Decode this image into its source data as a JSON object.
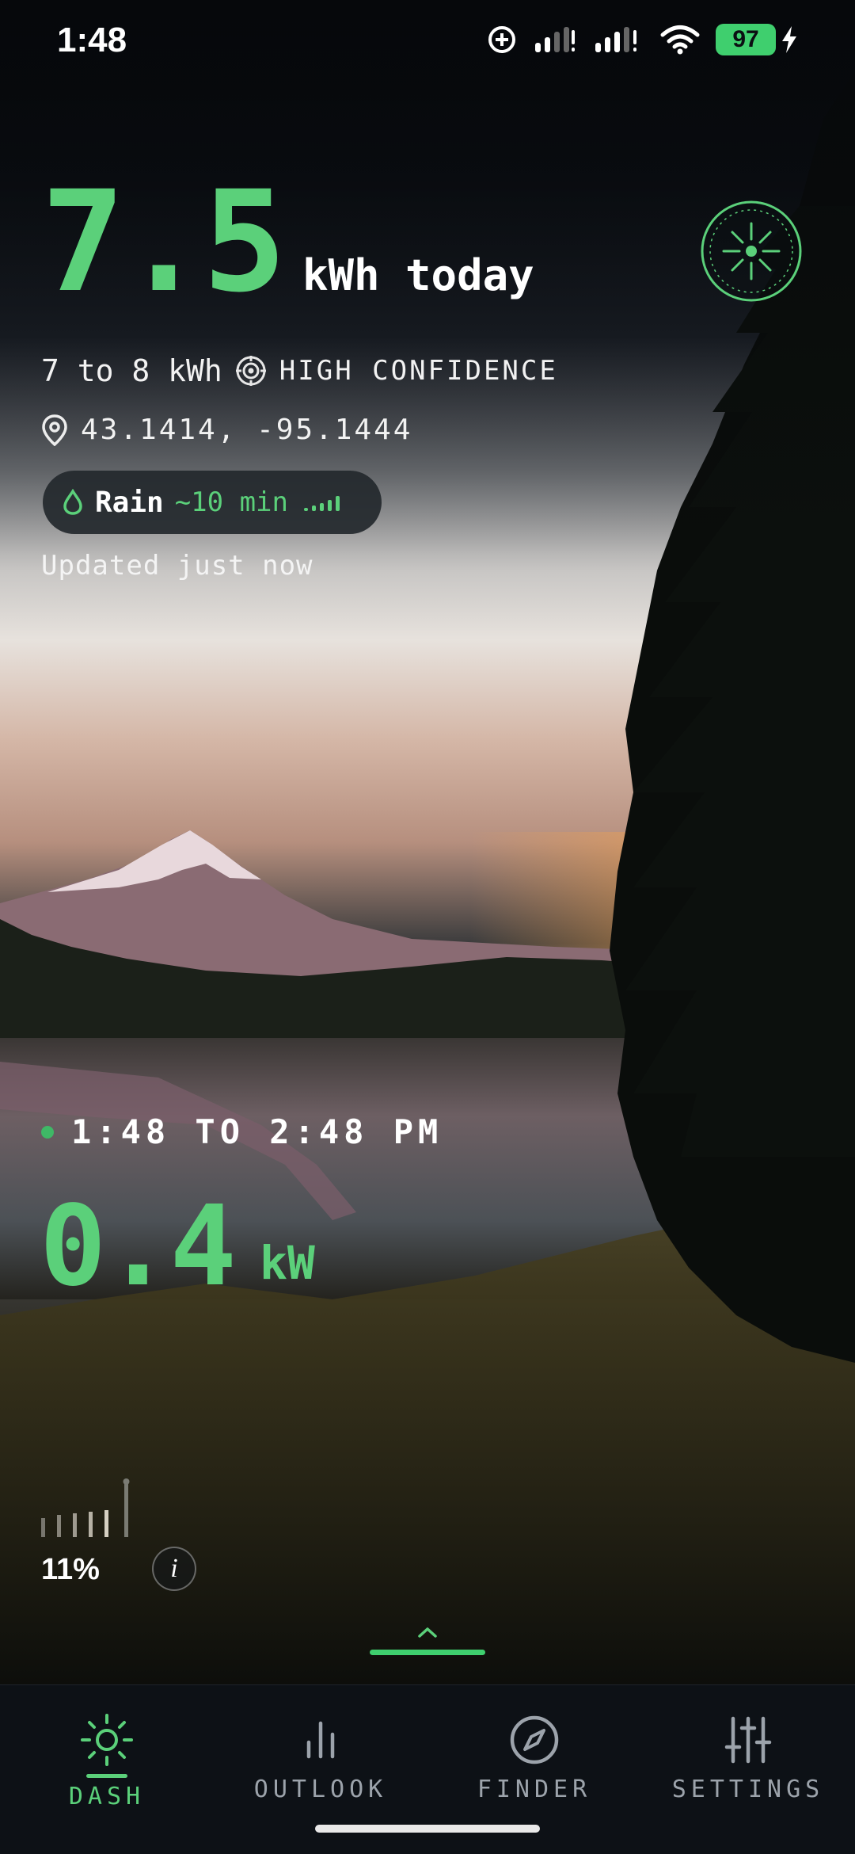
{
  "status_bar": {
    "time": "1:48",
    "battery": "97",
    "icons": [
      "orientation-lock-icon",
      "signal-icon",
      "signal-icon",
      "wifi-icon",
      "battery-icon",
      "charging-icon"
    ]
  },
  "hero": {
    "value": "7.5",
    "unit": "kWh today",
    "badge_icon": "sun-dial-icon"
  },
  "forecast": {
    "range": "7 to 8 kWh",
    "confidence": "HIGH CONFIDENCE",
    "coordinates": "43.1414, -95.1444"
  },
  "rain": {
    "label": "Rain",
    "eta": "~10 min",
    "intensity_levels": [
      0.2,
      0.3,
      0.45,
      0.65,
      0.85
    ]
  },
  "updated": "Updated just now",
  "window": {
    "range": "1:48 TO 2:48 PM",
    "value": "0.4",
    "unit": "kW"
  },
  "intensity": {
    "percent_label": "11%",
    "percent": 11,
    "info_label": "i"
  },
  "tabs": [
    {
      "label": "DASH",
      "icon": "sun-icon",
      "active": true
    },
    {
      "label": "OUTLOOK",
      "icon": "bar-chart-icon",
      "active": false
    },
    {
      "label": "FINDER",
      "icon": "compass-icon",
      "active": false
    },
    {
      "label": "SETTINGS",
      "icon": "sliders-icon",
      "active": false
    }
  ],
  "colors": {
    "accent": "#5bd07a",
    "tab_inactive": "#9ca3ab",
    "tab_bar_bg": "#0d1116"
  }
}
